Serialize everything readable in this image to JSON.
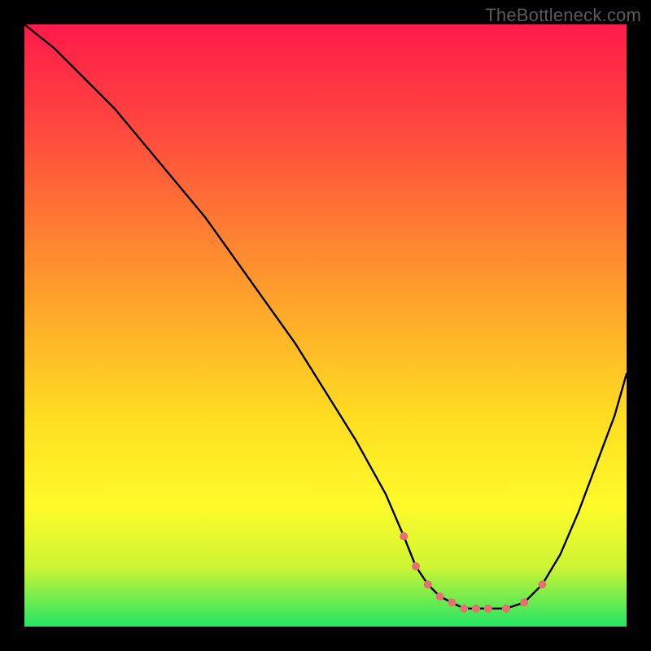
{
  "watermark": "TheBottleneck.com",
  "chart_data": {
    "type": "line",
    "title": "",
    "xlabel": "",
    "ylabel": "",
    "xlim": [
      0,
      100
    ],
    "ylim": [
      0,
      100
    ],
    "grid": false,
    "legend": false,
    "series": [
      {
        "name": "bottleneck-curve",
        "color": "#000000",
        "x": [
          0,
          5,
          10,
          15,
          20,
          25,
          30,
          35,
          40,
          45,
          50,
          55,
          60,
          63,
          65,
          67,
          69,
          71,
          73,
          75,
          77,
          80,
          83,
          86,
          89,
          92,
          95,
          98,
          100
        ],
        "values": [
          100,
          96,
          91,
          86,
          80,
          74,
          68,
          61,
          54,
          47,
          39,
          31,
          22,
          15,
          10,
          7,
          5,
          4,
          3,
          3,
          3,
          3,
          4,
          7,
          12,
          19,
          27,
          35,
          42
        ]
      }
    ],
    "markers": {
      "color": "#e86f6f",
      "radius": 5,
      "points": [
        {
          "x": 63,
          "y": 15
        },
        {
          "x": 65,
          "y": 10
        },
        {
          "x": 67,
          "y": 7
        },
        {
          "x": 69,
          "y": 5
        },
        {
          "x": 71,
          "y": 4
        },
        {
          "x": 73,
          "y": 3
        },
        {
          "x": 75,
          "y": 3
        },
        {
          "x": 77,
          "y": 3
        },
        {
          "x": 80,
          "y": 3
        },
        {
          "x": 83,
          "y": 4
        },
        {
          "x": 86,
          "y": 7
        }
      ]
    }
  }
}
